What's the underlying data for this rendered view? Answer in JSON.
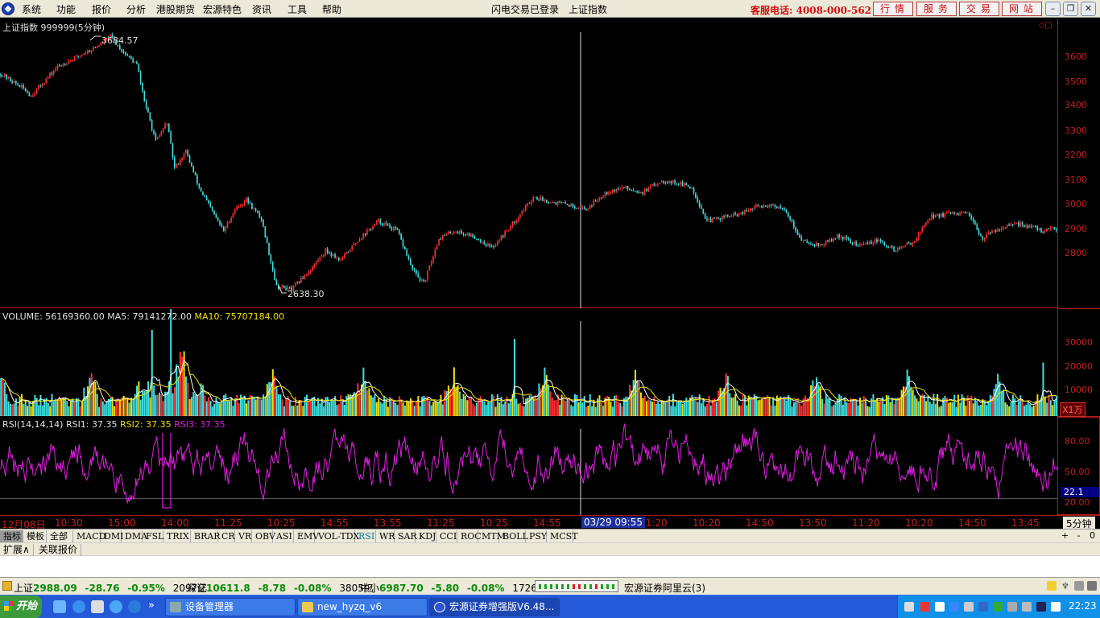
{
  "menubar": {
    "items": [
      "系统",
      "功能",
      "报价",
      "分析",
      "港股期货",
      "宏源特色",
      "资讯",
      "工具",
      "帮助"
    ],
    "status": "闪电交易已登录",
    "index_name": "上证指数",
    "hotline": "客服电话: 4008-000-562",
    "toolbar_buttons": [
      "行情",
      "服务",
      "交易",
      "网站"
    ]
  },
  "main_chart": {
    "title": "上证指数 999999(5分钟)",
    "high_label": "3684.57",
    "low_label": "2638.30",
    "y_ticks": [
      "3600",
      "3500",
      "3400",
      "3300",
      "3200",
      "3100",
      "3000",
      "2900",
      "2800"
    ]
  },
  "volume_panel": {
    "label_volume": "VOLUME: 56169360.00",
    "label_ma5": "MA5: 79141272.00",
    "label_ma10": "MA10: 75707184.00",
    "y_ticks": [
      "30000",
      "20000",
      "10000"
    ],
    "unit": "X1万"
  },
  "rsi_panel": {
    "label_prefix": "RSI(14,14,14)",
    "label_rsi1": "RSI1: 37.35",
    "label_rsi2": "RSI2: 37.35",
    "label_rsi3": "RSI3: 37.35",
    "y_ticks": [
      "80.00",
      "50.00",
      "20.00"
    ],
    "current_value": "22.1"
  },
  "time_axis": {
    "labels": [
      "12月08日",
      "10:30",
      "15:00",
      "14:00",
      "11:25",
      "10:25",
      "14:55",
      "13:55",
      "11:25",
      "10:25",
      "14:55",
      "11:20",
      "10:20",
      "14:50",
      "13:50",
      "11:20",
      "10:20",
      "14:50",
      "13:45"
    ],
    "cursor": "03/29 09:55",
    "period": "5分钟"
  },
  "indicator_tabs": [
    "指标",
    "模板",
    "全部",
    "MACD",
    "DMI",
    "DMA",
    "FSL",
    "TRIX",
    "BRAR",
    "CR",
    "VR",
    "OBV",
    "ASI",
    "EMV",
    "VOL-TDX",
    "RSI",
    "WR",
    "SAR",
    "KDJ",
    "CCI",
    "ROC",
    "MTM",
    "BOLL",
    "PSY",
    "MCST"
  ],
  "active_indicator": "RSI",
  "panel_controls": [
    "+",
    "-",
    "0"
  ],
  "ext_tabs": [
    "扩展∧",
    "关联报价"
  ],
  "statusbar": {
    "sh_name": "上证",
    "sh_value": "2988.09",
    "sh_change": "-28.76",
    "sh_pct": "-0.95%",
    "sh_amount": "2097亿",
    "sz_name": "深证",
    "sz_value": "10611.8",
    "sz_change": "-8.78",
    "sz_pct": "-0.08%",
    "sz_amount": "3805亿",
    "zx_name": "中小",
    "zx_value": "6987.70",
    "zx_change": "-5.80",
    "zx_pct": "-0.08%",
    "zx_amount": "1726亿",
    "server": "宏源证券阿里云(3)"
  },
  "taskbar": {
    "start": "开始",
    "more": "»",
    "tasks": [
      "设备管理器",
      "new_hyzq_v6",
      "宏源证券增强版V6.48..."
    ],
    "clock": "22:23"
  },
  "colors": {
    "up": "#ff3030",
    "down": "#40e0e0",
    "ma5": "#ffffff",
    "ma10": "#f0e000",
    "rsi": "#e020e0",
    "axis": "#c02020"
  }
}
